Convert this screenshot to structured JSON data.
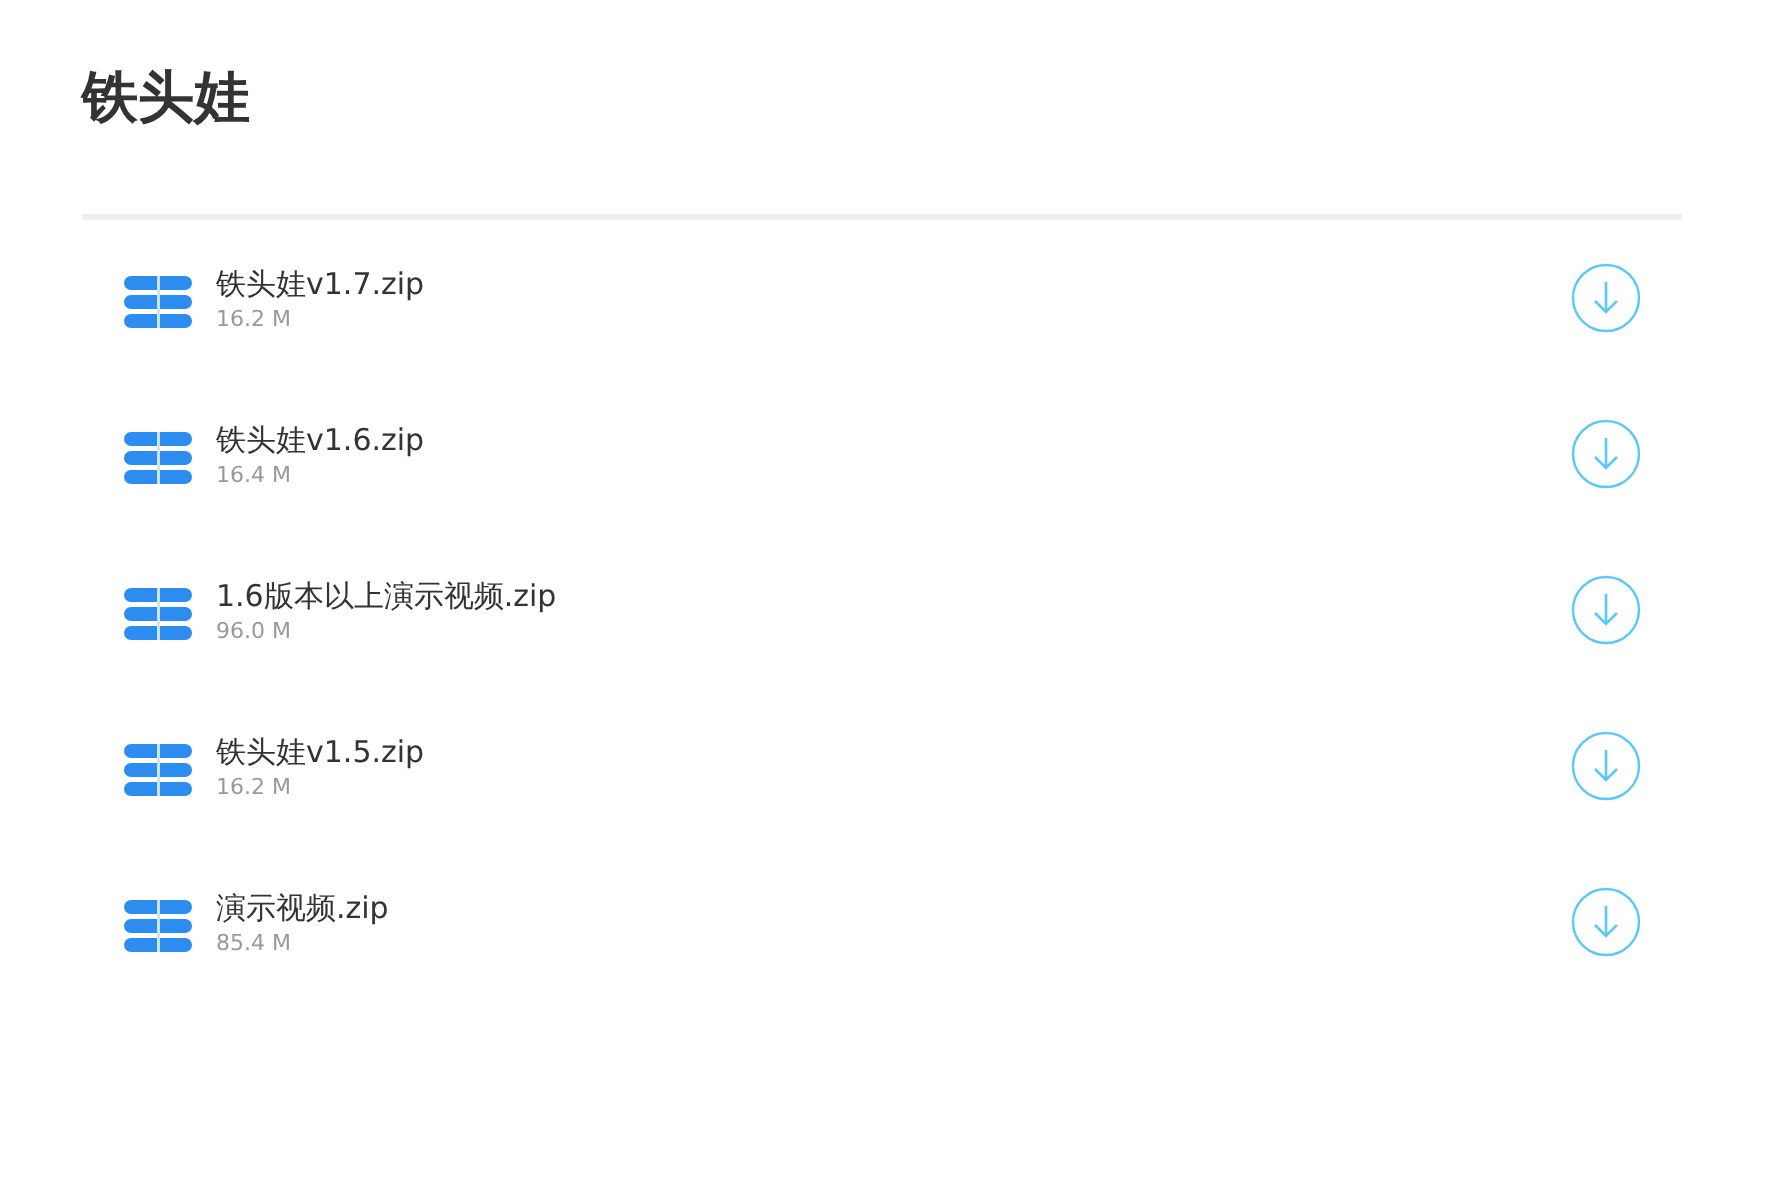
{
  "title": "铁头娃",
  "files": [
    {
      "name": "铁头娃v1.7.zip",
      "size": "16.2 M"
    },
    {
      "name": "铁头娃v1.6.zip",
      "size": "16.4 M"
    },
    {
      "name": "1.6版本以上演示视频.zip",
      "size": "96.0 M"
    },
    {
      "name": "铁头娃v1.5.zip",
      "size": "16.2 M"
    },
    {
      "name": "演示视频.zip",
      "size": "85.4 M"
    }
  ]
}
